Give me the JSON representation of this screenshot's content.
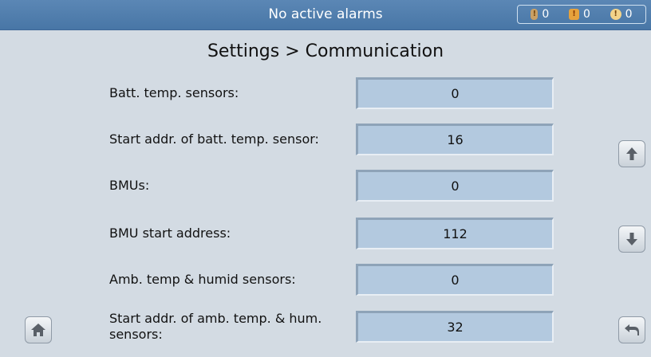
{
  "header": {
    "alarm_status": "No active alarms",
    "counters": [
      {
        "icon": "minor-alarm-icon",
        "value": "0"
      },
      {
        "icon": "major-alarm-icon",
        "value": "0"
      },
      {
        "icon": "critical-alarm-icon",
        "value": "0"
      }
    ]
  },
  "page": {
    "title": "Settings > Communication"
  },
  "settings": [
    {
      "label": "Batt. temp. sensors:",
      "value": "0"
    },
    {
      "label": "Start addr. of batt. temp. sensor:",
      "value": "16"
    },
    {
      "label": "BMUs:",
      "value": "0"
    },
    {
      "label": "BMU start address:",
      "value": "112"
    },
    {
      "label": "Amb. temp & humid sensors:",
      "value": "0"
    },
    {
      "label": "Start addr. of amb. temp. & hum. sensors:",
      "value": "32"
    }
  ],
  "buttons": {
    "up_icon": "arrow-up-icon",
    "down_icon": "arrow-down-icon",
    "home_icon": "home-icon",
    "back_icon": "back-icon"
  }
}
